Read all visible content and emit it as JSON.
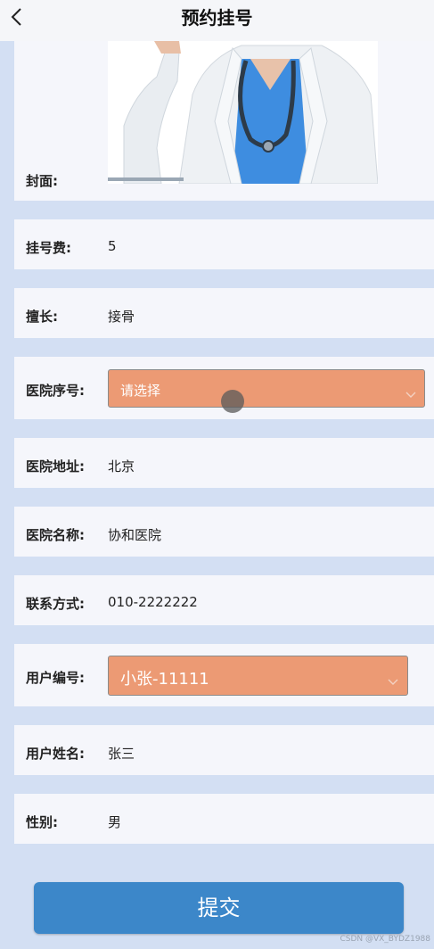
{
  "header": {
    "title": "预约挂号"
  },
  "form": {
    "cover_label": "封面:",
    "fee_label": "挂号费:",
    "fee_value": "5",
    "specialty_label": "擅长:",
    "specialty_value": "接骨",
    "hospital_no_label": "医院序号:",
    "hospital_no_placeholder": "请选择",
    "hospital_addr_label": "医院地址:",
    "hospital_addr_value": "北京",
    "hospital_name_label": "医院名称:",
    "hospital_name_value": "协和医院",
    "contact_label": "联系方式:",
    "contact_value": "010-2222222",
    "user_no_label": "用户编号:",
    "user_no_value": "小张-11111",
    "user_name_label": "用户姓名:",
    "user_name_value": "张三",
    "gender_label": "性别:",
    "gender_value": "男"
  },
  "submit_label": "提交",
  "watermark": "CSDN @VX_BYDZ1988",
  "colors": {
    "background": "#d3dff3",
    "card": "#f5f6fb",
    "select": "#ec9a74",
    "button": "#3c87c9"
  }
}
